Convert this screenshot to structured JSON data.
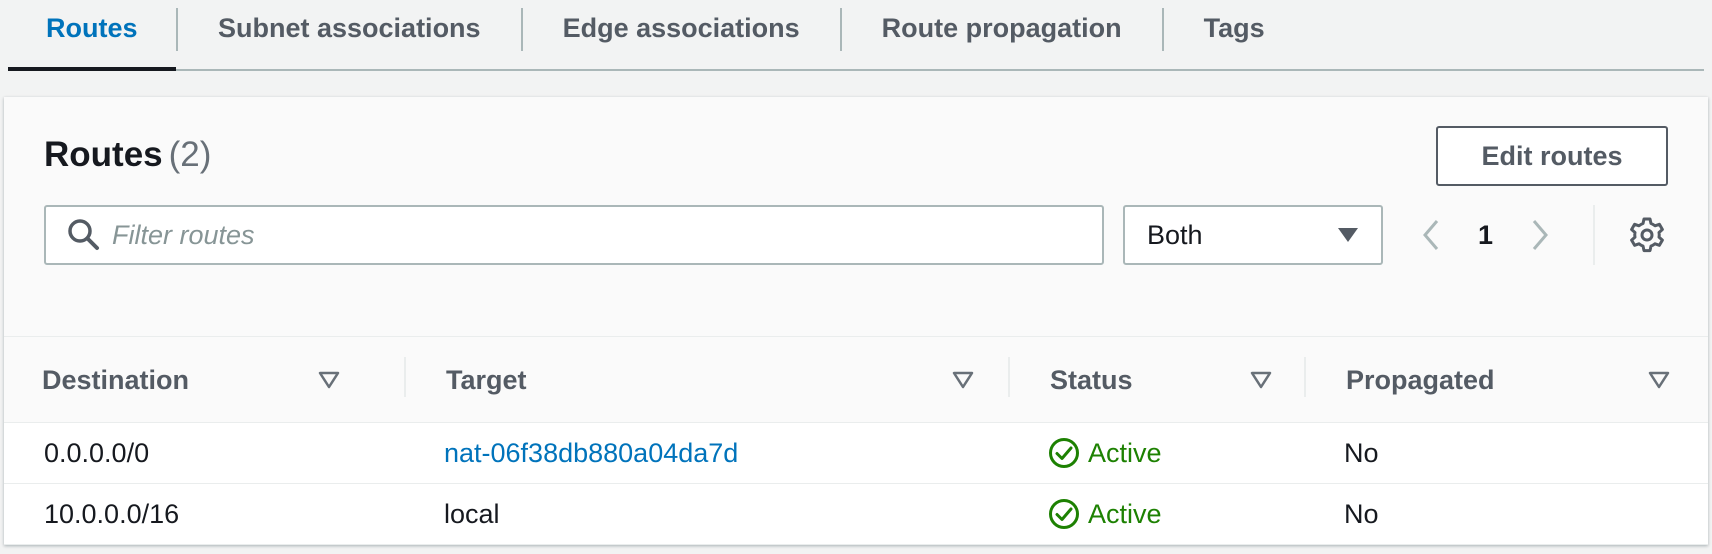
{
  "tabs": [
    {
      "label": "Routes",
      "active": true
    },
    {
      "label": "Subnet associations",
      "active": false
    },
    {
      "label": "Edge associations",
      "active": false
    },
    {
      "label": "Route propagation",
      "active": false
    },
    {
      "label": "Tags",
      "active": false
    }
  ],
  "panel": {
    "title": "Routes",
    "count": "(2)",
    "edit_button": "Edit routes"
  },
  "filter": {
    "placeholder": "Filter routes",
    "value": ""
  },
  "select": {
    "value": "Both"
  },
  "pagination": {
    "current_page": "1"
  },
  "table": {
    "columns": [
      "Destination",
      "Target",
      "Status",
      "Propagated"
    ],
    "rows": [
      {
        "destination": "0.0.0.0/0",
        "target": "nat-06f38db880a04da7d",
        "status": "Active",
        "propagated": "No"
      },
      {
        "destination": "10.0.0.0/16",
        "target": "local",
        "status": "Active",
        "propagated": "No"
      }
    ]
  },
  "icons": {
    "search": "search-icon",
    "settings": "gear-icon",
    "status_ok": "check-circle-icon",
    "sort": "sort-triangle-icon"
  },
  "colors": {
    "accent": "#0073bb",
    "status_active": "#1d8102",
    "tab_underline": "#16191f"
  }
}
